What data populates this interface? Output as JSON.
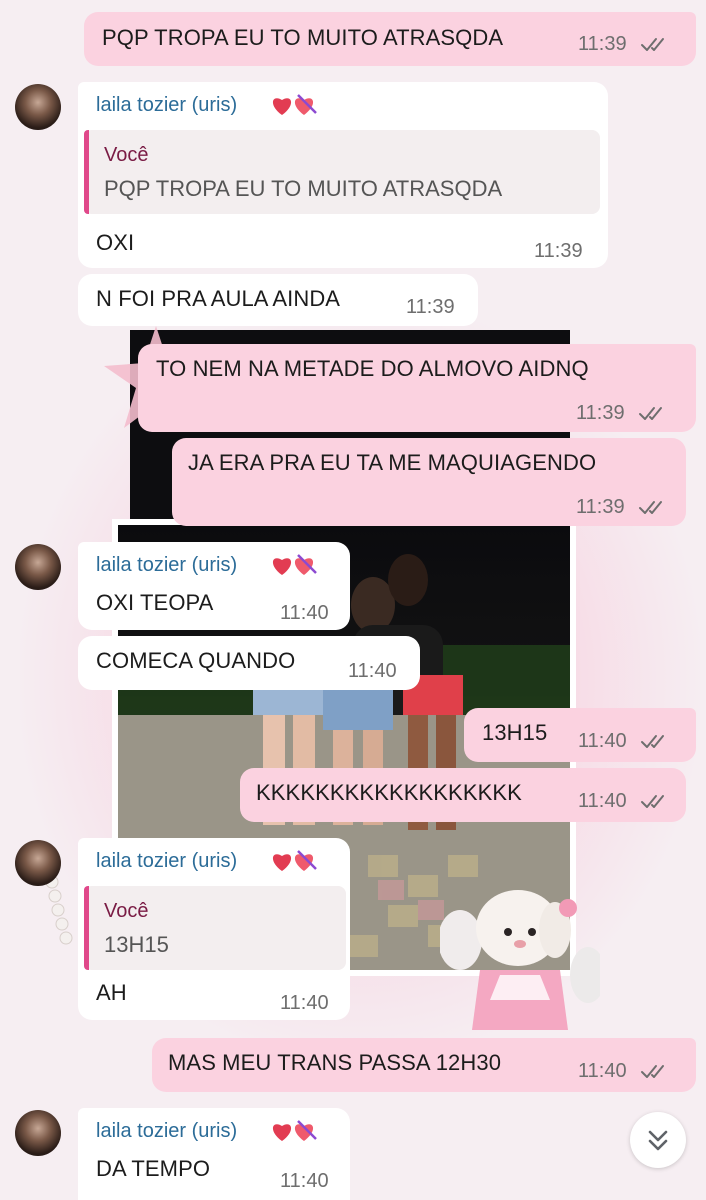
{
  "contact": {
    "name": "laila tozier (uris)",
    "heart_icons": "heart-icons"
  },
  "reply_sender_self": "Você",
  "messages": [
    {
      "dir": "out",
      "text": "PQP TROPA EU TO MUITO ATRASQDA",
      "time": "11:39"
    },
    {
      "dir": "in",
      "text": "OXI",
      "time": "11:39",
      "reply_to": "PQP TROPA EU TO MUITO ATRASQDA"
    },
    {
      "dir": "in",
      "text": "N FOI PRA AULA AINDA",
      "time": "11:39"
    },
    {
      "dir": "out",
      "text": "TO NEM NA METADE DO ALMOVO AIDNQ",
      "time": "11:39"
    },
    {
      "dir": "out",
      "text": "JA ERA PRA EU TA ME MAQUIAGENDO",
      "time": "11:39"
    },
    {
      "dir": "in",
      "text": "OXI TEOPA",
      "time": "11:40"
    },
    {
      "dir": "in",
      "text": "COMECA QUANDO",
      "time": "11:40"
    },
    {
      "dir": "out",
      "text": "13H15",
      "time": "11:40"
    },
    {
      "dir": "out",
      "text": "KKKKKKKKKKKKKKKKKK",
      "time": "11:40"
    },
    {
      "dir": "in",
      "text": "AH",
      "time": "11:40",
      "reply_to": "13H15"
    },
    {
      "dir": "out",
      "text": "MAS MEU TRANS PASSA 12H30",
      "time": "11:40"
    },
    {
      "dir": "in",
      "text": "DA TEMPO",
      "time": "11:40"
    }
  ],
  "colors": {
    "outgoing_bubble": "#fbd2e0",
    "incoming_bubble": "#ffffff",
    "sender_name": "#2c6c98",
    "reply_accent": "#e0488a"
  },
  "icons": {
    "read_receipt": "double-check-icon",
    "scroll_down": "double-chevron-down-icon"
  }
}
